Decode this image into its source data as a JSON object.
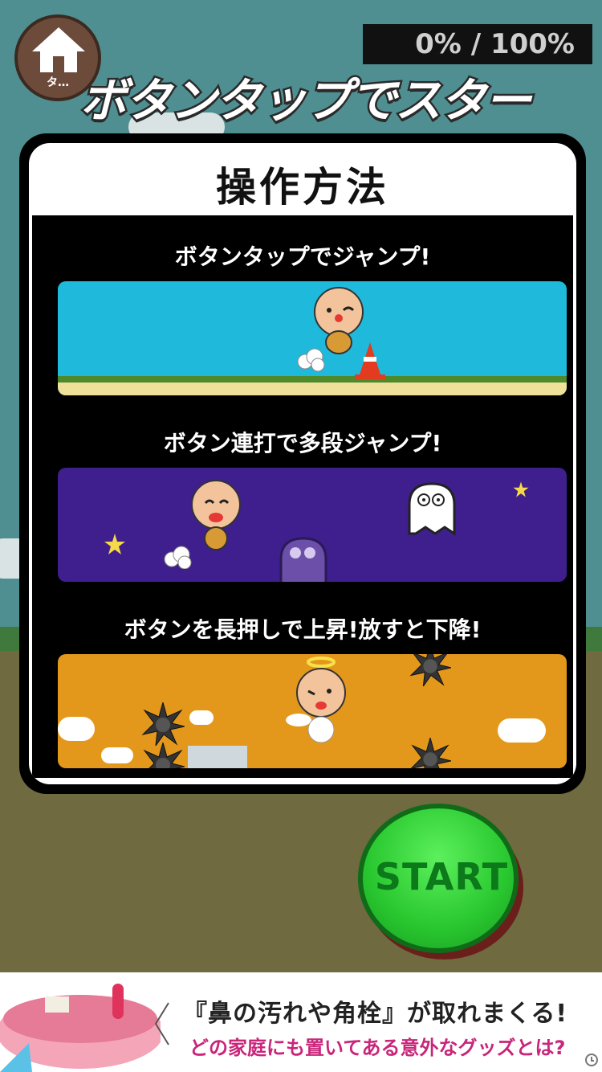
{
  "progress_text": "0% / 100%",
  "home": {
    "label": "タ…",
    "icon": "home-icon"
  },
  "banner": {
    "title": "ボタンタップでスタート!"
  },
  "panel": {
    "title": "操作方法",
    "instructions": [
      {
        "caption": "ボタンタップでジャンプ!"
      },
      {
        "caption": "ボタン連打で多段ジャンプ!"
      },
      {
        "caption": "ボタンを長押しで上昇!放すと下降!"
      }
    ]
  },
  "start": {
    "label": "START"
  },
  "ad": {
    "line1": "『鼻の汚れや角栓』が取れまくる!",
    "line2": "どの家庭にも置いてある意外なグッズとは?"
  },
  "colors": {
    "scene1": "#1fb9dc",
    "scene2": "#3e1f8d",
    "scene3": "#e3981c",
    "start": "#29c72f"
  }
}
